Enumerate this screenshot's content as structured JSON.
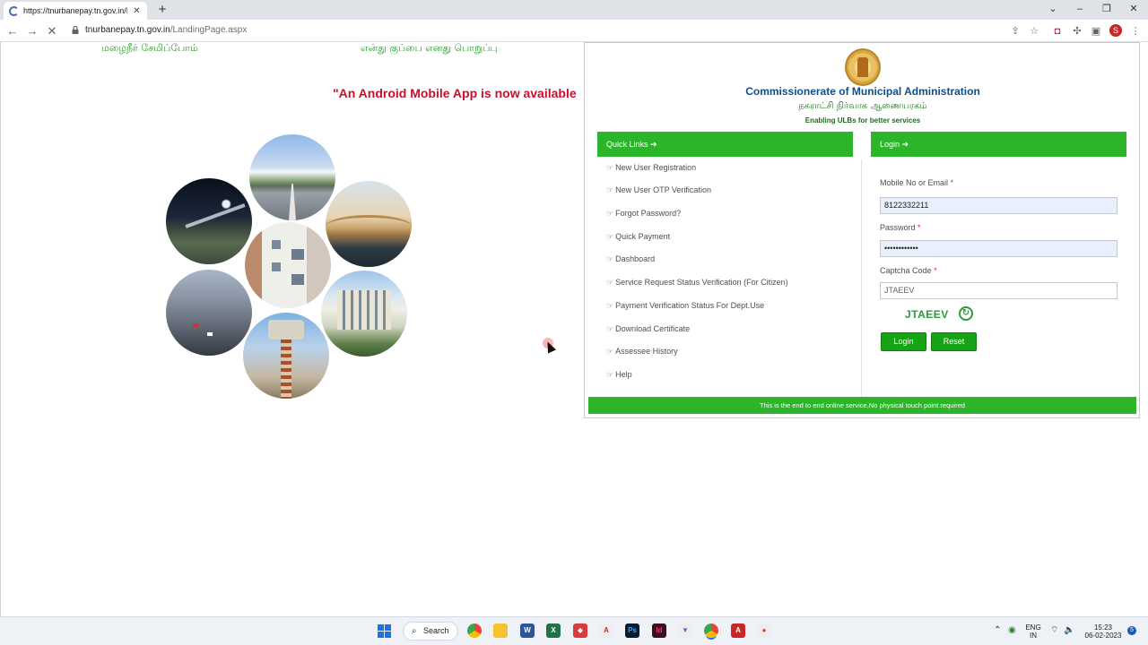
{
  "browser": {
    "tab_title": "https://tnurbanepay.tn.gov.in/La",
    "url_host": "tnurbanepay.tn.gov.in",
    "url_path": "/LandingPage.aspx",
    "profile_initial": "S"
  },
  "page": {
    "tamil_left": "மழைநீர் சேமிப்போம்",
    "tamil_mid": "என்து குப்பை எனது பொறுப்பு",
    "android_banner": "\"An Android Mobile App is now available"
  },
  "header": {
    "org_title": "Commissionerate of Municipal Administration",
    "org_tamil": "நகராட்சி நிர்வாக ஆணையரகம்",
    "tagline": "Enabling ULBs for better services"
  },
  "quick_links": {
    "heading": "Quick Links",
    "items": [
      "New User Registration",
      "New User OTP Verification",
      "Forgot Password?",
      "Quick Payment",
      "Dashboard",
      "Service Request Status Verification (For Citizen)",
      "Payment Verification Status For Dept.Use",
      "Download Certificate",
      "Assessee History",
      "Help"
    ]
  },
  "login": {
    "heading": "Login",
    "mobile_label": "Mobile No or Email",
    "mobile_value": "8122332211",
    "password_label": "Password",
    "password_value": "••••••••••••",
    "captcha_label": "Captcha Code",
    "captcha_input": "JTAEEV",
    "captcha_image_text": "JTAEEV",
    "required_mark": "*",
    "login_button": "Login",
    "reset_button": "Reset"
  },
  "footer_bar": "This is the end to end online service,No physical touch point required",
  "taskbar": {
    "search_label": "Search",
    "lang_top": "ENG",
    "lang_bottom": "IN",
    "time": "15:23",
    "date": "06-02-2023"
  },
  "colors": {
    "green_bar": "#2cb52a",
    "button_green": "#16a316",
    "title_blue": "#0e4f8a",
    "banner_red": "#c8102e"
  }
}
